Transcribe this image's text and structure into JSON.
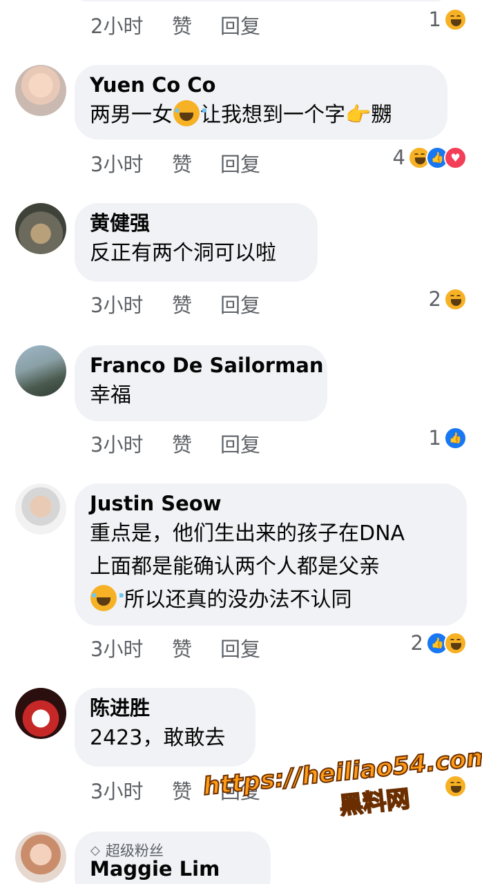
{
  "comments": [
    {
      "name": "",
      "text": "",
      "time": "2小时",
      "like_label": "赞",
      "reply_label": "回复",
      "reaction_count": "1",
      "reactions": [
        "haha"
      ]
    },
    {
      "name": "Yuen Co Co",
      "text_parts": [
        "两男一女",
        "让我想到一个字",
        "嬲"
      ],
      "time": "3小时",
      "like_label": "赞",
      "reply_label": "回复",
      "reaction_count": "4",
      "reactions": [
        "haha",
        "like",
        "love"
      ]
    },
    {
      "name": "黄健强",
      "text": "反正有两个洞可以啦",
      "time": "3小时",
      "like_label": "赞",
      "reply_label": "回复",
      "reaction_count": "2",
      "reactions": [
        "haha"
      ]
    },
    {
      "name": "Franco De Sailorman",
      "text": "幸福",
      "time": "3小时",
      "like_label": "赞",
      "reply_label": "回复",
      "reaction_count": "1",
      "reactions": [
        "like"
      ]
    },
    {
      "name": "Justin Seow",
      "text_lines": [
        "重点是，他们生出来的孩子在DNA",
        "上面都是能确认两个人都是父亲",
        " 所以还真的没办法不认同"
      ],
      "time": "3小时",
      "like_label": "赞",
      "reply_label": "回复",
      "reaction_count": "2",
      "reactions": [
        "like",
        "haha"
      ]
    },
    {
      "name": "陈进胜",
      "text": "2423，敢敢去",
      "time": "3小时",
      "like_label": "赞",
      "reply_label": "回复",
      "reaction_count": "",
      "reactions": [
        "haha"
      ]
    },
    {
      "badge": "超级粉丝",
      "name": "Maggie Lim"
    }
  ],
  "watermark": {
    "url": "https://heiliao54.com",
    "cn": "黑料网"
  },
  "colors": {
    "bubble": "#f0f2f5",
    "meta_text": "#5d6166",
    "like_blue": "#1877f2",
    "love_red": "#f33e58",
    "haha_yellow": "#f7b125"
  },
  "icons": {
    "haha": "haha-reaction-icon",
    "like": "like-reaction-icon",
    "love": "love-reaction-icon",
    "gem": "gem-icon"
  }
}
